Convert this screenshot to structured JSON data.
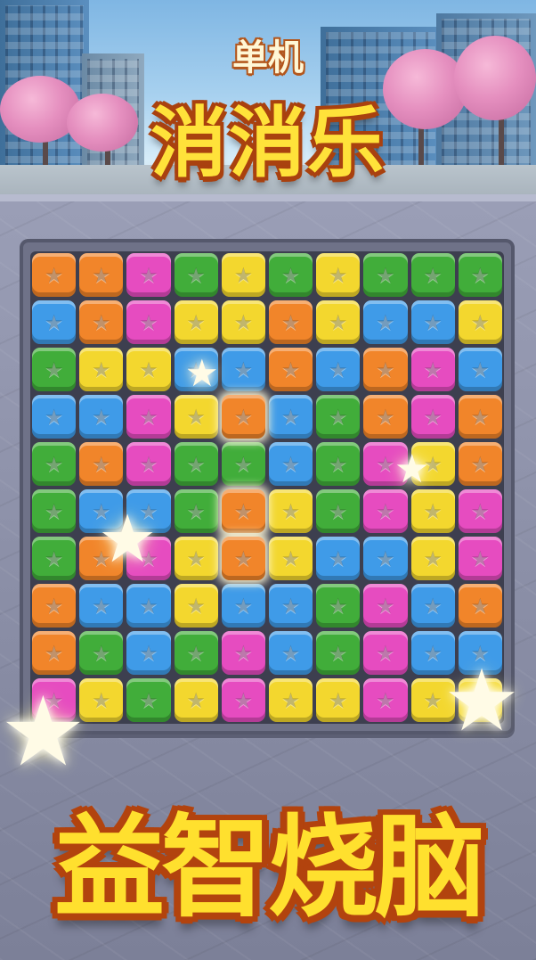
{
  "header": {
    "subtitle": "单机",
    "title": "消消乐"
  },
  "board": {
    "rows": 10,
    "cols": 10,
    "tile_icon": "star-icon",
    "colors": {
      "O": "#f1852a",
      "P": "#e64cc0",
      "G": "#41ad3a",
      "Y": "#f3d72e",
      "B": "#3f9be8"
    },
    "grid": [
      [
        "O",
        "O",
        "P",
        "G",
        "Y",
        "G",
        "Y",
        "G",
        "G",
        "G"
      ],
      [
        "B",
        "O",
        "P",
        "Y",
        "Y",
        "O",
        "Y",
        "B",
        "B",
        "Y"
      ],
      [
        "G",
        "Y",
        "Y",
        "B",
        "B",
        "O",
        "B",
        "O",
        "P",
        "B"
      ],
      [
        "B",
        "B",
        "P",
        "Y",
        "O",
        "B",
        "G",
        "O",
        "P",
        "O"
      ],
      [
        "G",
        "O",
        "P",
        "G",
        "G",
        "B",
        "G",
        "P",
        "Y",
        "O"
      ],
      [
        "G",
        "B",
        "B",
        "G",
        "O",
        "Y",
        "G",
        "P",
        "Y",
        "P"
      ],
      [
        "G",
        "O",
        "P",
        "Y",
        "O",
        "Y",
        "B",
        "B",
        "Y",
        "P"
      ],
      [
        "O",
        "B",
        "B",
        "Y",
        "B",
        "B",
        "G",
        "P",
        "B",
        "O"
      ],
      [
        "O",
        "G",
        "B",
        "G",
        "P",
        "B",
        "G",
        "P",
        "B",
        "B"
      ],
      [
        "P",
        "Y",
        "G",
        "Y",
        "P",
        "Y",
        "Y",
        "P",
        "Y",
        "Y"
      ]
    ],
    "highlighted": [
      [
        3,
        4
      ],
      [
        5,
        4
      ],
      [
        6,
        4
      ]
    ]
  },
  "footer": {
    "slogan": "益智烧脑"
  }
}
